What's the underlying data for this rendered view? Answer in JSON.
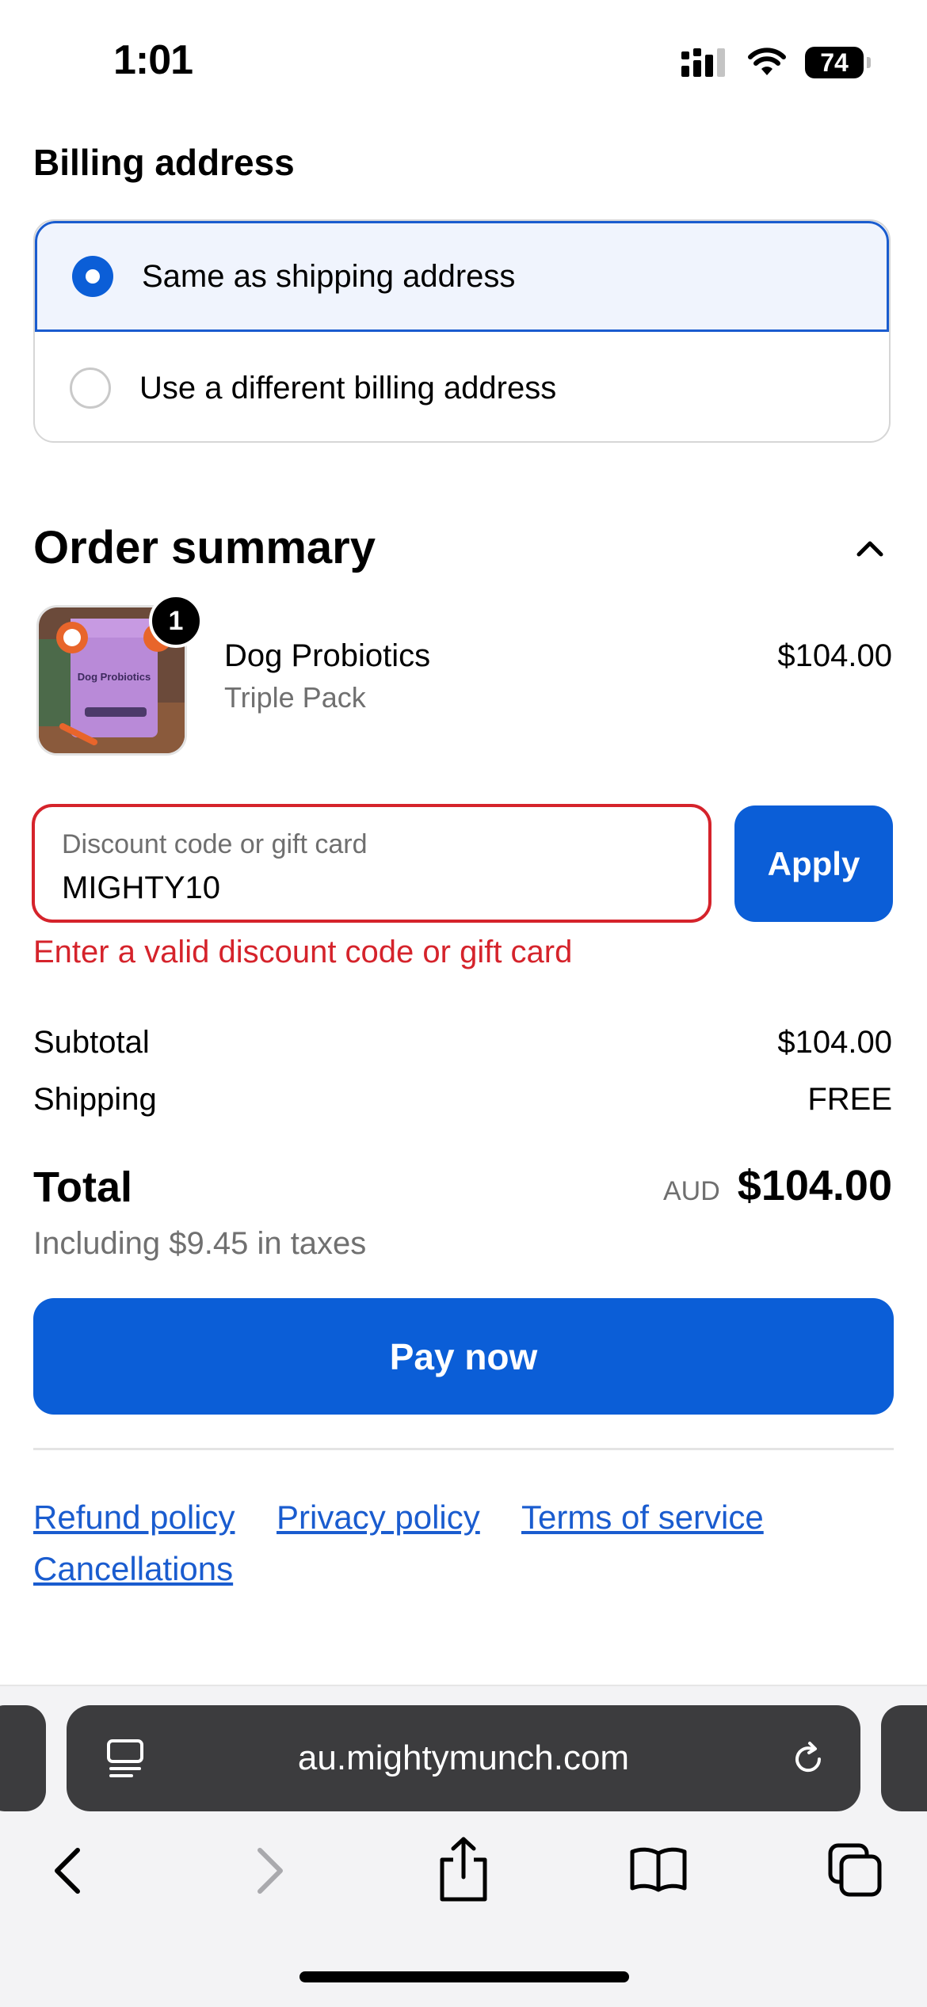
{
  "status_bar": {
    "time": "1:01",
    "battery": "74"
  },
  "billing": {
    "title": "Billing address",
    "options": [
      {
        "label": "Same as shipping address",
        "selected": true
      },
      {
        "label": "Use a different billing address",
        "selected": false
      }
    ]
  },
  "order_summary": {
    "title": "Order summary",
    "product": {
      "name": "Dog Probiotics",
      "variant": "Triple Pack",
      "price": "$104.00",
      "quantity": "1",
      "image_text": "Dog Probiotics"
    }
  },
  "discount": {
    "placeholder": "Discount code or gift card",
    "value": "MIGHTY10",
    "apply_label": "Apply",
    "error": "Enter a valid discount code or gift card"
  },
  "totals": {
    "subtotal_label": "Subtotal",
    "subtotal_value": "$104.00",
    "shipping_label": "Shipping",
    "shipping_value": "FREE",
    "total_label": "Total",
    "currency": "AUD",
    "total_value": "$104.00",
    "tax_note": "Including $9.45 in taxes"
  },
  "pay_label": "Pay now",
  "footer_links": [
    "Refund policy",
    "Privacy policy",
    "Terms of service",
    "Cancellations"
  ],
  "browser": {
    "url": "au.mightymunch.com"
  },
  "colors": {
    "primary": "#0b5ed7",
    "error": "#d5232b",
    "link": "#1a5ccf",
    "selected_bg": "#f0f4fd"
  }
}
